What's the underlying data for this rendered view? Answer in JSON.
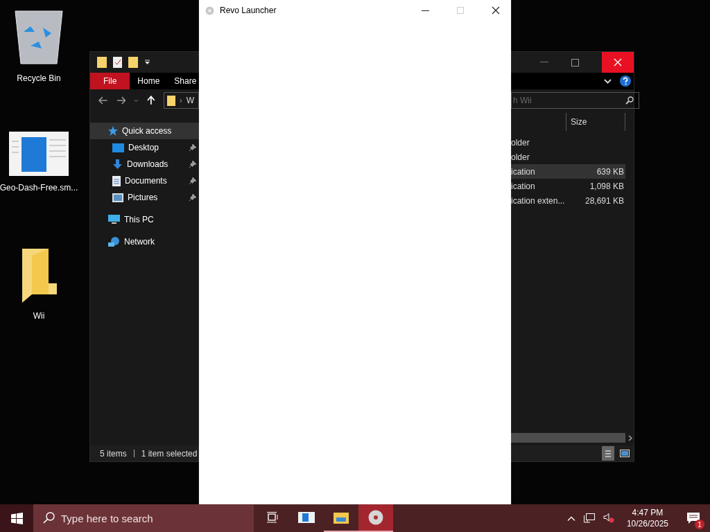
{
  "desktop_icons": [
    {
      "label": "Recycle Bin",
      "kind": "recycle"
    },
    {
      "label": "Geo-Dash-Free.sm...",
      "kind": "thumb"
    },
    {
      "label": "Wii",
      "kind": "folder"
    }
  ],
  "explorer": {
    "ribbon_tabs": [
      {
        "label": "File",
        "selected": true
      },
      {
        "label": "Home",
        "selected": false
      },
      {
        "label": "Share",
        "selected": false
      }
    ],
    "address": "W",
    "address_separator": "›",
    "search": {
      "placeholder": "h Wii"
    },
    "nav_items": [
      {
        "label": "Quick access",
        "kind": "star",
        "selected": true,
        "children": [
          {
            "label": "Desktop",
            "kind": "desktop",
            "pinned": true
          },
          {
            "label": "Downloads",
            "kind": "download",
            "pinned": true
          },
          {
            "label": "Documents",
            "kind": "document",
            "pinned": true
          },
          {
            "label": "Pictures",
            "kind": "picture",
            "pinned": true
          }
        ]
      },
      {
        "label": "This PC",
        "kind": "pc",
        "selected": false
      },
      {
        "label": "Network",
        "kind": "network",
        "selected": false
      }
    ],
    "columns": [
      "Size"
    ],
    "rows": [
      {
        "type": "older",
        "selected": false
      },
      {
        "type": "older",
        "selected": false
      },
      {
        "type": "ication",
        "size": "639 KB",
        "selected": true
      },
      {
        "type": "ication",
        "size": "1,098 KB",
        "selected": false
      },
      {
        "type": "ication exten...",
        "size": "28,691 KB",
        "selected": false
      }
    ],
    "status": {
      "items": "5 items",
      "selection": "1 item selected"
    }
  },
  "revo": {
    "title": "Revo Launcher"
  },
  "taskbar": {
    "search_placeholder": "Type here to search",
    "apps": [
      {
        "kind": "taskview",
        "running": false,
        "selected": false
      },
      {
        "kind": "app",
        "running": false,
        "selected": false
      },
      {
        "kind": "explorer",
        "running": true,
        "selected": false
      },
      {
        "kind": "disc",
        "running": true,
        "selected": true
      }
    ],
    "time": "4:47 PM",
    "date": "10/26/2025",
    "notification_count": "1"
  }
}
